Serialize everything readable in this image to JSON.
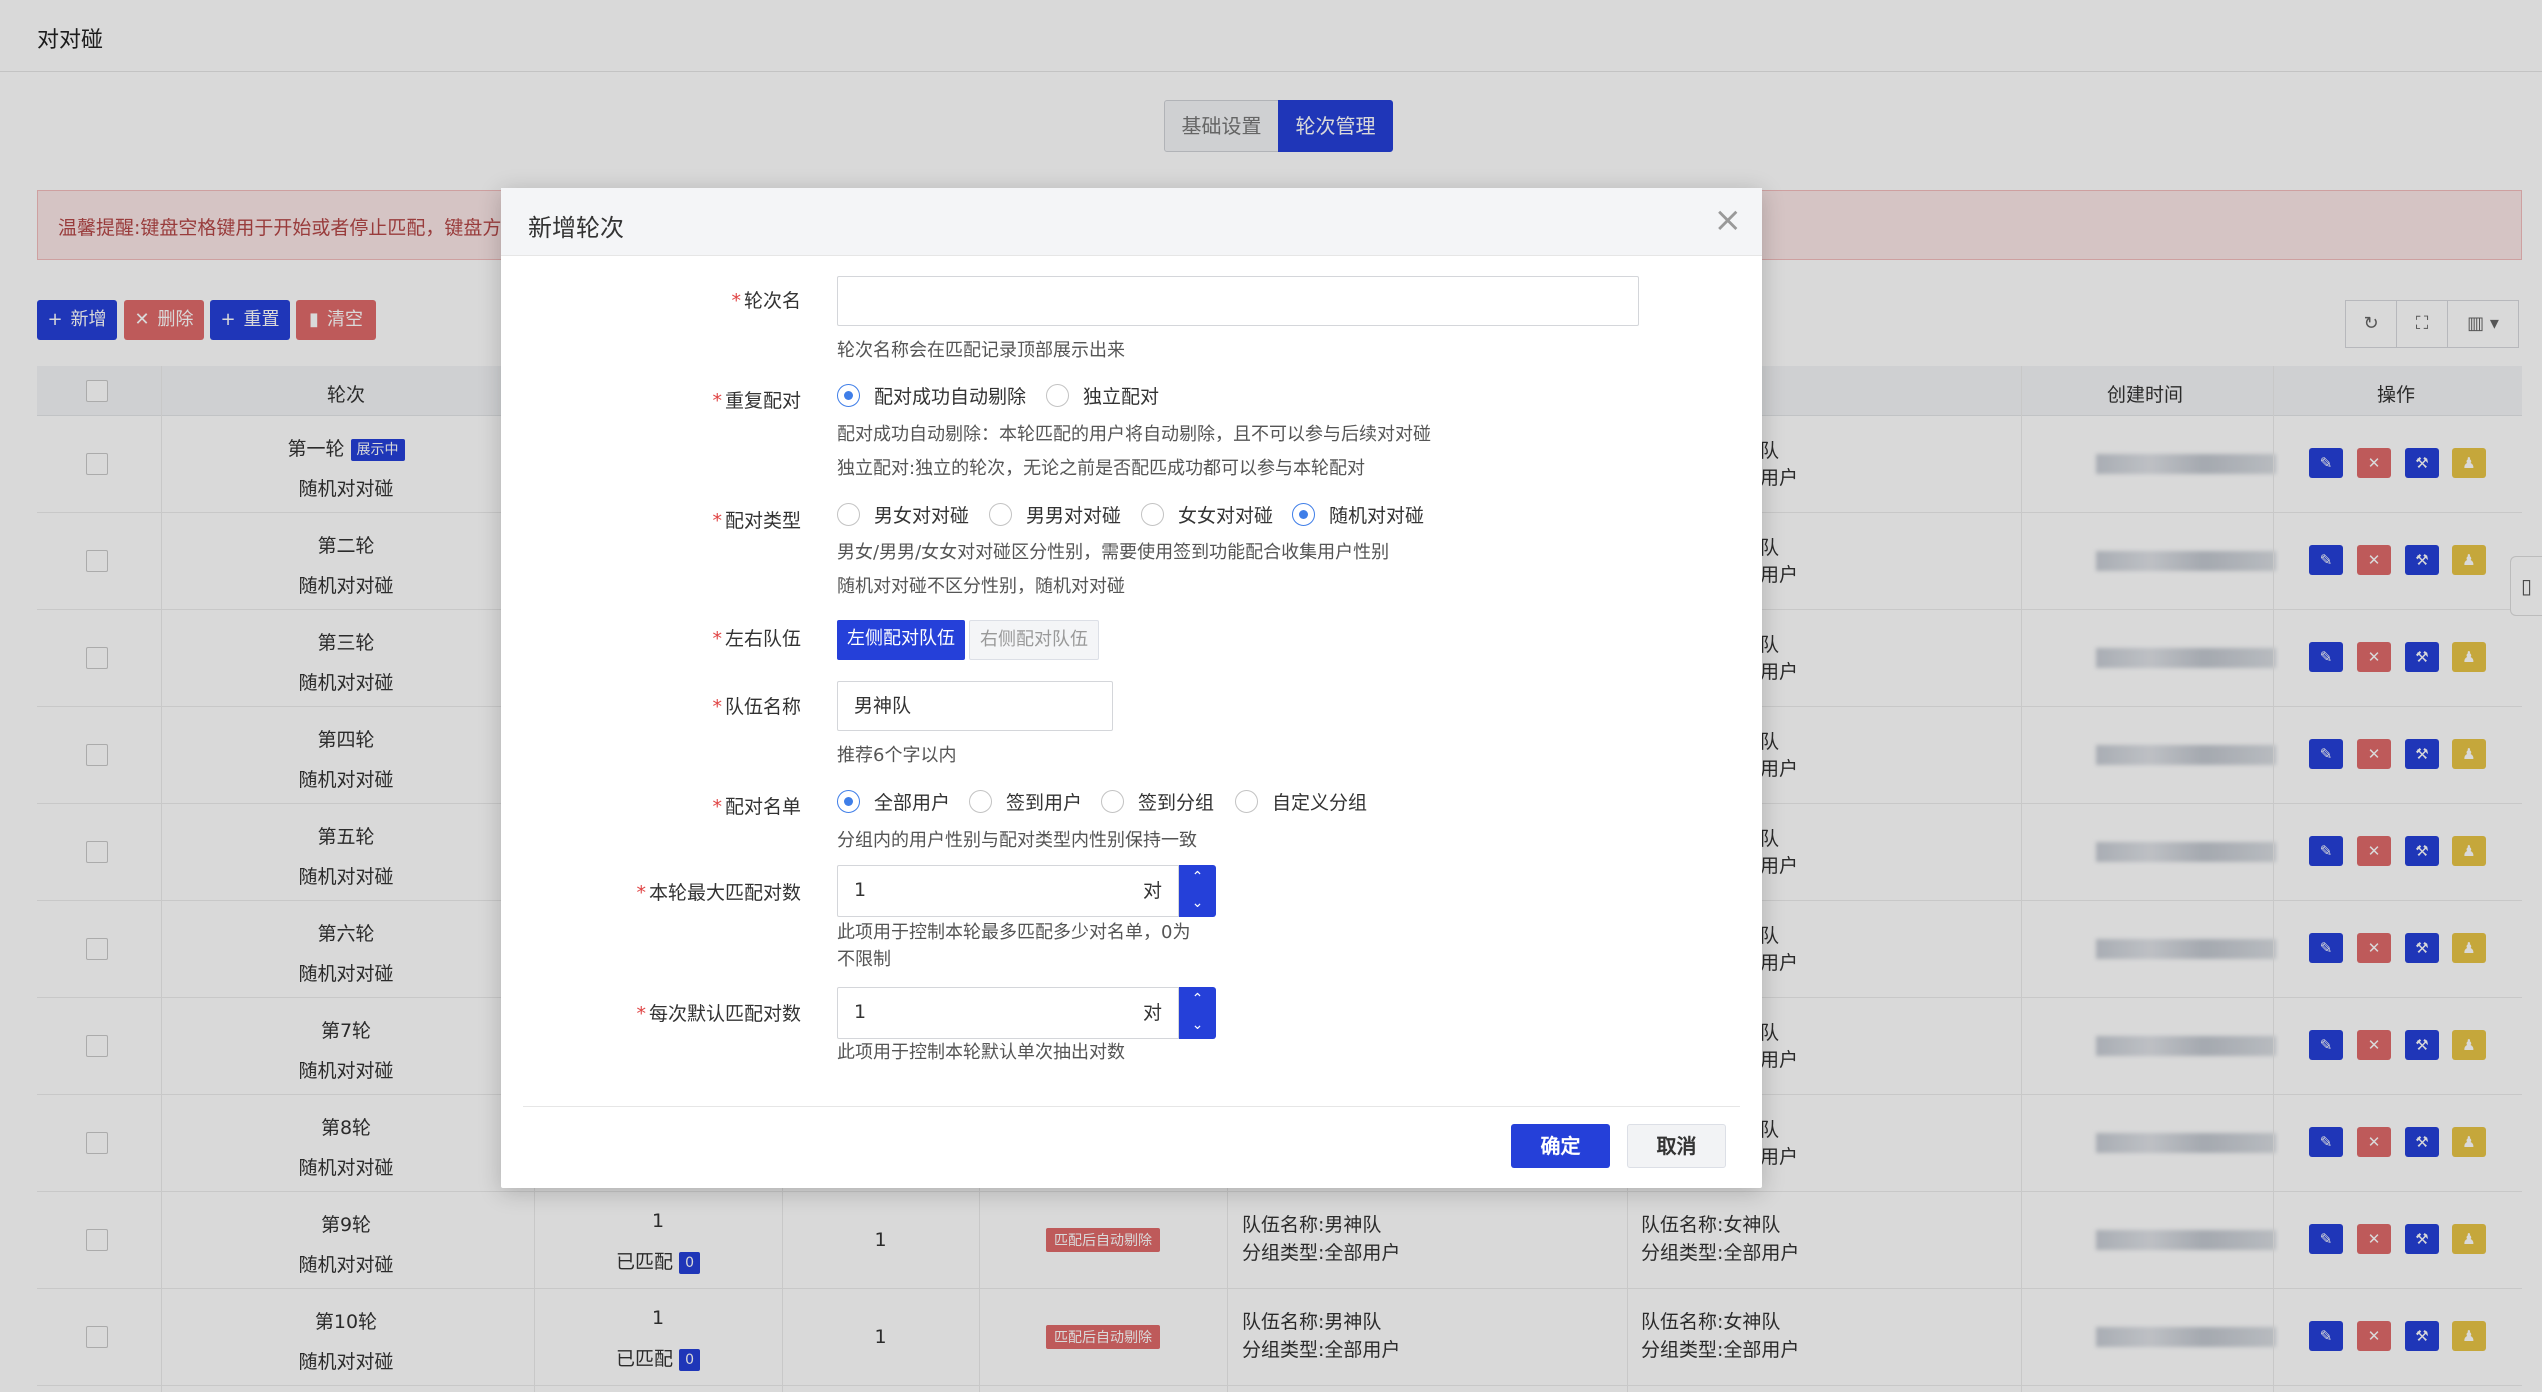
{
  "app": {
    "title": "对对碰"
  },
  "tabs": [
    {
      "label": "基础设置",
      "active": false
    },
    {
      "label": "轮次管理",
      "active": true
    }
  ],
  "alert": {
    "text": "温馨提醒:键盘空格键用于开始或者停止匹配，键盘方向"
  },
  "toolbar": {
    "add_label": "新增",
    "delete_label": "删除",
    "reset_label": "重置",
    "clear_label": "清空",
    "refresh_icon": "refresh-icon",
    "fullscreen_icon": "fullscreen-icon",
    "columns_icon": "columns-icon"
  },
  "table": {
    "headers": {
      "round": "轮次",
      "created": "创建时间",
      "ops": "操作"
    },
    "rows": [
      {
        "name": "第一轮",
        "type": "随机对对碰",
        "tag": "展示中",
        "left": "队",
        "right": "用户"
      },
      {
        "name": "第二轮",
        "type": "随机对对碰",
        "left": "队",
        "right": "用户"
      },
      {
        "name": "第三轮",
        "type": "随机对对碰",
        "left": "队",
        "right": "用户"
      },
      {
        "name": "第四轮",
        "type": "随机对对碰",
        "left": "队",
        "right": "用户"
      },
      {
        "name": "第五轮",
        "type": "随机对对碰",
        "left": "队",
        "right": "用户"
      },
      {
        "name": "第六轮",
        "type": "随机对对碰",
        "left": "队",
        "right": "用户"
      },
      {
        "name": "第7轮",
        "type": "随机对对碰",
        "left": "队",
        "right": "用户"
      },
      {
        "name": "第8轮",
        "type": "随机对对碰",
        "left": "队",
        "right": "用户"
      },
      {
        "name": "第9轮",
        "type": "随机对对碰",
        "max": "1",
        "matched_label": "已匹配",
        "matched": "0",
        "default": "1",
        "status": "匹配后自动剔除",
        "left_team": "队伍名称:男神队",
        "left_group": "分组类型:全部用户",
        "right_team": "队伍名称:女神队",
        "right_group": "分组类型:全部用户"
      },
      {
        "name": "第10轮",
        "type": "随机对对碰",
        "max": "1",
        "matched_label": "已匹配",
        "matched": "0",
        "default": "1",
        "status": "匹配后自动剔除",
        "left_team": "队伍名称:男神队",
        "left_group": "分组类型:全部用户",
        "right_team": "队伍名称:女神队",
        "right_group": "分组类型:全部用户"
      }
    ]
  },
  "modal": {
    "title": "新增轮次",
    "fields": {
      "round_name": {
        "label": "轮次名",
        "value": "",
        "help": "轮次名称会在匹配记录顶部展示出来"
      },
      "repeat": {
        "label": "重复配对",
        "options": [
          "配对成功自动剔除",
          "独立配对"
        ],
        "selected": 0,
        "help1": "配对成功自动剔除：本轮匹配的用户将自动剔除，且不可以参与后续对对碰",
        "help2": "独立配对:独立的轮次，无论之前是否配匹成功都可以参与本轮配对"
      },
      "pair_type": {
        "label": "配对类型",
        "options": [
          "男女对对碰",
          "男男对对碰",
          "女女对对碰",
          "随机对对碰"
        ],
        "selected": 3,
        "help1": "男女/男男/女女对对碰区分性别，需要使用签到功能配合收集用户性别",
        "help2": "随机对对碰不区分性别，随机对对碰"
      },
      "side": {
        "label": "左右队伍",
        "left": "左侧配对队伍",
        "right": "右侧配对队伍"
      },
      "team_name": {
        "label": "队伍名称",
        "value": "男神队",
        "help": "推荐6个字以内"
      },
      "pair_list": {
        "label": "配对名单",
        "options": [
          "全部用户",
          "签到用户",
          "签到分组",
          "自定义分组"
        ],
        "selected": 0,
        "help": "分组内的用户性别与配对类型内性别保持一致"
      },
      "max_pairs": {
        "label": "本轮最大匹配对数",
        "value": "1",
        "unit": "对",
        "help1": "此项用于控制本轮最多匹配多少对名单，0为",
        "help2": "不限制"
      },
      "default_pairs": {
        "label": "每次默认匹配对数",
        "value": "1",
        "unit": "对",
        "help": "此项用于控制本轮默认单次抽出对数"
      }
    },
    "ok_label": "确定",
    "cancel_label": "取消"
  }
}
